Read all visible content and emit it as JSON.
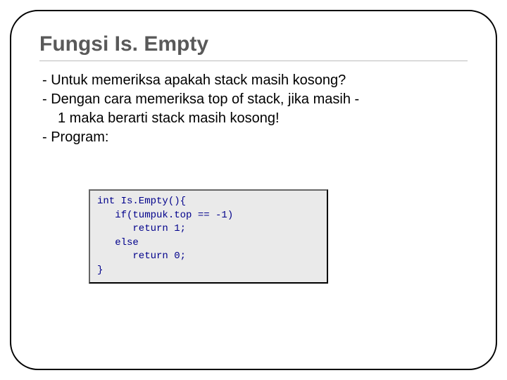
{
  "title": "Fungsi Is. Empty",
  "bullets": {
    "b1": "- Untuk memeriksa apakah stack masih kosong?",
    "b2a": "- Dengan cara memeriksa top of stack, jika masih -",
    "b2b": "1 maka berarti stack masih kosong!",
    "b3": "- Program:"
  },
  "code": {
    "l1": "int Is.Empty(){",
    "l2": "   if(tumpuk.top == -1)",
    "l3": "      return 1;",
    "l4": "   else",
    "l5": "      return 0;",
    "l6": "}"
  },
  "slide_number": ""
}
